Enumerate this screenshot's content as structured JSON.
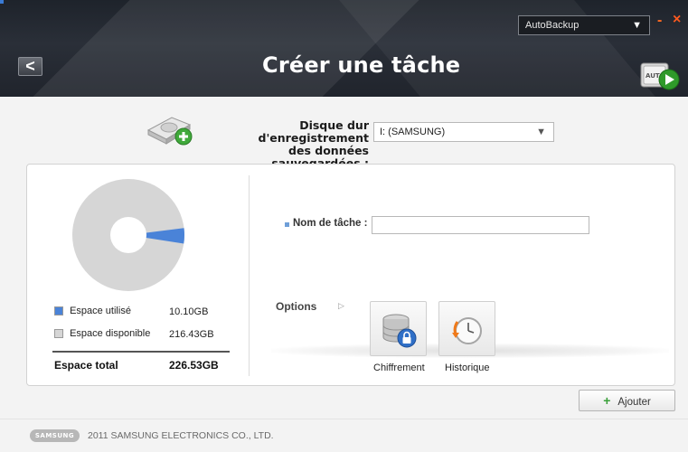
{
  "header": {
    "title": "Créer une tâche",
    "back_glyph": "<",
    "app_select_value": "AutoBackup",
    "minimize_glyph": "-",
    "close_glyph": "×",
    "autoplay_icon_text": "AUTO"
  },
  "disk": {
    "label_line1": "Disque dur d'enregistrement",
    "label_line2": "des données sauvegardées :",
    "selected": "I: (SAMSUNG)"
  },
  "storage": {
    "used_label": "Espace utilisé",
    "used_value": "10.10GB",
    "free_label": "Espace disponible",
    "free_value": "216.43GB",
    "total_label": "Espace total",
    "total_value": "226.53GB",
    "used_fraction": 0.0446,
    "used_color": "#4a83d8",
    "free_color": "#d6d6d6"
  },
  "task": {
    "name_label": "Nom de tâche :",
    "name_value": ""
  },
  "options": {
    "label": "Options",
    "encryption_label": "Chiffrement",
    "history_label": "Historique"
  },
  "actions": {
    "add_label": "Ajouter"
  },
  "footer": {
    "logo_text": "SAMSUNG",
    "copyright": "2011 SAMSUNG ELECTRONICS CO., LTD."
  }
}
